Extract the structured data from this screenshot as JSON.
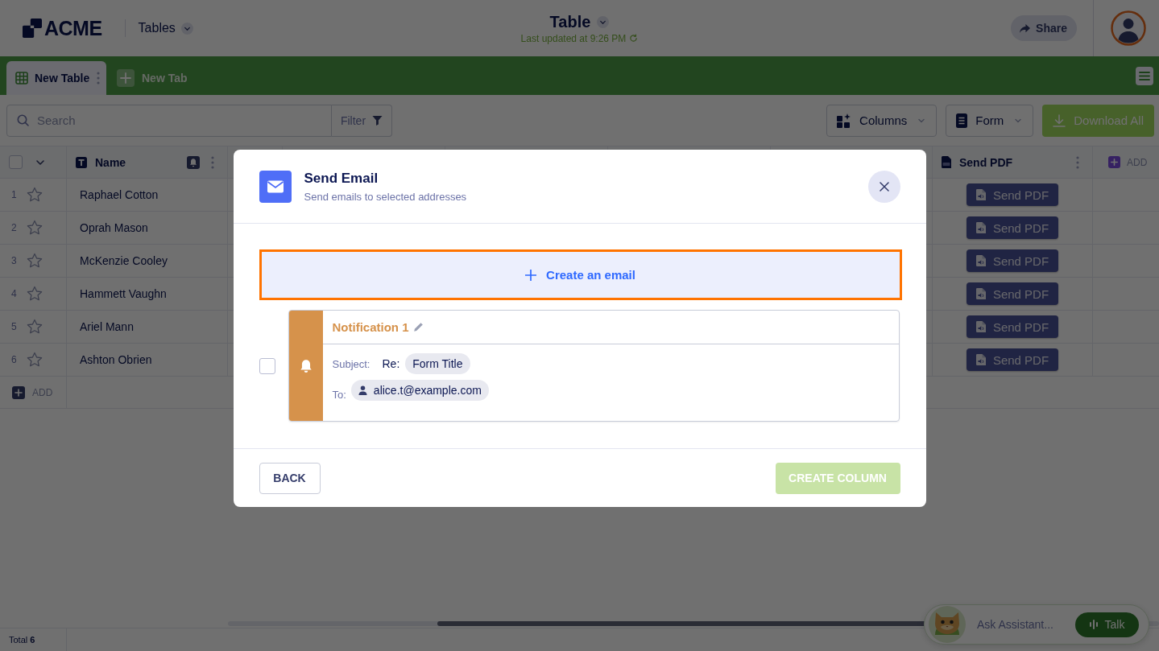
{
  "header": {
    "logo": "ACME",
    "workspace": "Tables",
    "title": "Table",
    "last_updated": "Last updated at 9:26 PM",
    "share_button": "Share"
  },
  "tabs": [
    {
      "label": "New Table",
      "selected": true
    }
  ],
  "new_tab_button": "New Tab",
  "toolbar": {
    "search": {
      "placeholder": "Search"
    },
    "filter_button": "Filter",
    "columns_button": "Columns",
    "form_button": "Form",
    "download_button": "Download All"
  },
  "table": {
    "select_all": {
      "checked": false
    },
    "columns": [
      {
        "label": "Name",
        "kind": "text"
      },
      {
        "label": "Send PDF",
        "kind": "pdf"
      }
    ],
    "add_column": "ADD",
    "rows": [
      {
        "number": "1",
        "starred": false,
        "name": "Raphael Cotton",
        "action": "Send PDF"
      },
      {
        "number": "2",
        "starred": false,
        "name": "Oprah Mason",
        "action": "Send PDF"
      },
      {
        "number": "3",
        "starred": false,
        "name": "McKenzie Cooley",
        "action": "Send PDF"
      },
      {
        "number": "4",
        "starred": false,
        "name": "Hammett Vaughn",
        "action": "Send PDF"
      },
      {
        "number": "5",
        "starred": false,
        "name": "Ariel Mann",
        "action": "Send PDF"
      },
      {
        "number": "6",
        "starred": false,
        "name": "Ashton Obrien",
        "action": "Send PDF"
      }
    ],
    "add_row": "ADD"
  },
  "status_bar": {
    "total": "Total **6**"
  },
  "assistant": {
    "placeholder": "Ask Assistant...",
    "talk_button": "Talk"
  },
  "modal": {
    "title": "Send Email",
    "subtitle": "Send emails to selected addresses",
    "create_button": {
      "label": "Create an email",
      "highlighted": true
    },
    "notifications": [
      {
        "title": "Notification 1",
        "checked": false,
        "subject_label": "Subject:",
        "subject_prefix": "Re:",
        "subject": "Form Title",
        "to_label": "To:",
        "recipients": [
          "alice.t@example.com"
        ]
      }
    ],
    "back_button": "BACK",
    "create_column_button": {
      "label": "CREATE COLUMN",
      "disabled": true
    }
  }
}
